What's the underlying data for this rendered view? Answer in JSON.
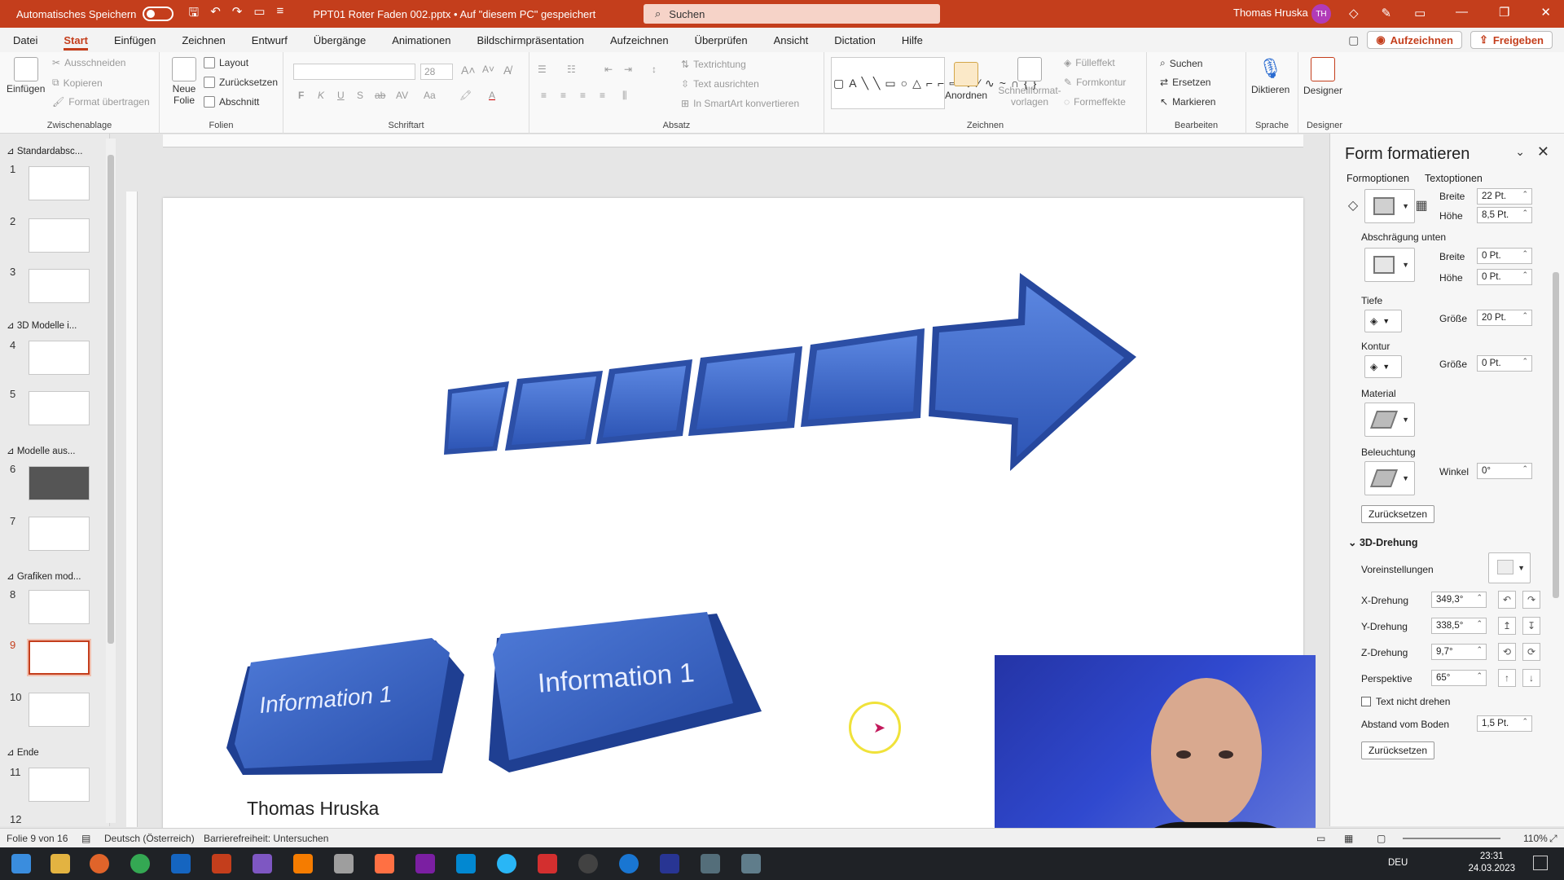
{
  "titlebar": {
    "autosave_label": "Automatisches Speichern",
    "document_title": "PPT01 Roter Faden 002.pptx  •  Auf \"diesem PC\" gespeichert",
    "search_placeholder": "Suchen",
    "user_name": "Thomas Hruska",
    "user_initials": "TH"
  },
  "menu": {
    "tabs": [
      "Datei",
      "Start",
      "Einfügen",
      "Zeichnen",
      "Entwurf",
      "Übergänge",
      "Animationen",
      "Bildschirmpräsentation",
      "Aufzeichnen",
      "Überprüfen",
      "Ansicht",
      "Dictation",
      "Hilfe"
    ],
    "active_tab": "Start",
    "record_label": "Aufzeichnen",
    "share_label": "Freigeben"
  },
  "ribbon": {
    "clipboard": {
      "paste": "Einfügen",
      "cut": "Ausschneiden",
      "copy": "Kopieren",
      "format_painter": "Format übertragen",
      "label": "Zwischenablage"
    },
    "slides": {
      "new_slide": "Neue Folie",
      "layout": "Layout",
      "reset": "Zurücksetzen",
      "section": "Abschnitt",
      "label": "Folien"
    },
    "font": {
      "size": "28",
      "bold": "F",
      "italic": "K",
      "underline": "U",
      "shadow": "S",
      "strike": "ab",
      "case": "Aa",
      "label": "Schriftart"
    },
    "paragraph": {
      "text_direction": "Textrichtung",
      "align_text": "Text ausrichten",
      "smartart": "In SmartArt konvertieren",
      "label": "Absatz"
    },
    "drawing": {
      "arrange": "Anordnen",
      "quick_styles": "Schnellformat-vorlagen",
      "fill": "Fülleffekt",
      "outline": "Formkontur",
      "effects": "Formeffekte",
      "label": "Zeichnen"
    },
    "editing": {
      "find": "Suchen",
      "replace": "Ersetzen",
      "select": "Markieren",
      "label": "Bearbeiten"
    },
    "voice": {
      "dictate": "Diktieren",
      "label": "Sprache"
    },
    "designer": {
      "designer": "Designer",
      "label": "Designer"
    }
  },
  "slides_panel": {
    "sections": [
      "Standardabsc...",
      "3D Modelle i...",
      "Modelle aus...",
      "Grafiken mod...",
      "Ende"
    ],
    "numbers": [
      "1",
      "2",
      "3",
      "4",
      "5",
      "6",
      "7",
      "8",
      "9",
      "10",
      "11",
      "12"
    ],
    "selected": "9"
  },
  "slide": {
    "button1_text": "Information 1",
    "button2_text": "Information 1",
    "presenter": "Thomas Hruska",
    "colors": {
      "shape_blue": "#3c67c9",
      "shape_dark": "#1e3c8c"
    }
  },
  "format_pane": {
    "title": "Form formatieren",
    "tab_shape": "Formoptionen",
    "tab_text": "Textoptionen",
    "top_bevel": {
      "width_label": "Breite",
      "width": "22 Pt.",
      "height_label": "Höhe",
      "height": "8,5 Pt."
    },
    "bottom_bevel": {
      "label": "Abschrägung unten",
      "width_label": "Breite",
      "width": "0 Pt.",
      "height_label": "Höhe",
      "height": "0 Pt."
    },
    "depth": {
      "label": "Tiefe",
      "size_label": "Größe",
      "size": "20 Pt."
    },
    "contour": {
      "label": "Kontur",
      "size_label": "Größe",
      "size": "0 Pt."
    },
    "material_label": "Material",
    "lighting": {
      "label": "Beleuchtung",
      "angle_label": "Winkel",
      "angle": "0°"
    },
    "reset": "Zurücksetzen",
    "rotation": {
      "header": "3D-Drehung",
      "presets": "Voreinstellungen",
      "x_label": "X-Drehung",
      "x": "349,3°",
      "y_label": "Y-Drehung",
      "y": "338,5°",
      "z_label": "Z-Drehung",
      "z": "9,7°",
      "perspective_label": "Perspektive",
      "perspective": "65°",
      "keep_text_flat": "Text nicht drehen",
      "distance_label": "Abstand vom Boden",
      "distance": "1,5 Pt.",
      "reset": "Zurücksetzen"
    }
  },
  "statusbar": {
    "slide_info": "Folie 9 von 16",
    "language": "Deutsch (Österreich)",
    "accessibility": "Barrierefreiheit: Untersuchen",
    "zoom": "110%"
  },
  "taskbar": {
    "time": "23:31",
    "date": "24.03.2023",
    "lang": "DEU"
  }
}
